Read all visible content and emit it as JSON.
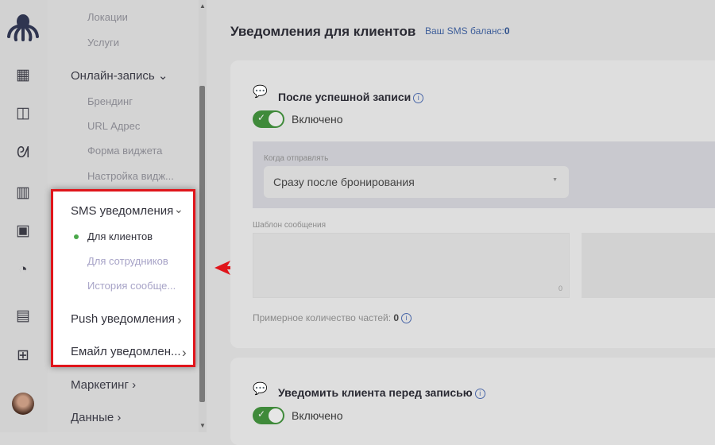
{
  "sidebar": {
    "rail_icons": [
      "octopus-logo",
      "calendar-icon",
      "calendar-clock-icon",
      "clients-icon",
      "clipboard-icon",
      "money-icon",
      "pie-chart-icon",
      "window-icon",
      "apps-add-icon",
      "avatar"
    ],
    "items_top": [
      "Локации",
      "Услуги"
    ],
    "online_booking": {
      "label": "Онлайн-запись",
      "children": [
        "Брендинг",
        "URL Адрес",
        "Форма виджета",
        "Настройка видж..."
      ]
    },
    "sms": {
      "label": "SMS уведомления",
      "children": [
        "Для клиентов",
        "Для сотрудников",
        "История сообще..."
      ],
      "active": "Для клиентов"
    },
    "push": "Push уведомления",
    "email": "Емайл уведомлен...",
    "marketing": "Маркетинг",
    "data": "Данные"
  },
  "main": {
    "title": "Уведомления для клиентов",
    "balance_label": "Ваш SMS баланс:",
    "balance_value": "0",
    "card1": {
      "title": "После успешной записи",
      "toggle_label": "Включено",
      "toggle_on": true,
      "when_label": "Когда отправлять",
      "when_value": "Сразу после бронирования",
      "template_label": "Шаблон сообщения",
      "template_value": "",
      "char_count": "0",
      "parts_label": "Примерное количество частей:",
      "parts_value": "0"
    },
    "card2": {
      "title": "Уведомить клиента перед записью",
      "toggle_label": "Включено",
      "toggle_on": true
    }
  },
  "colors": {
    "highlight_border": "#e0151b",
    "toggle_on": "#3f8a3a",
    "active_dot": "#4aa84a",
    "arrow": "#e0151b"
  }
}
